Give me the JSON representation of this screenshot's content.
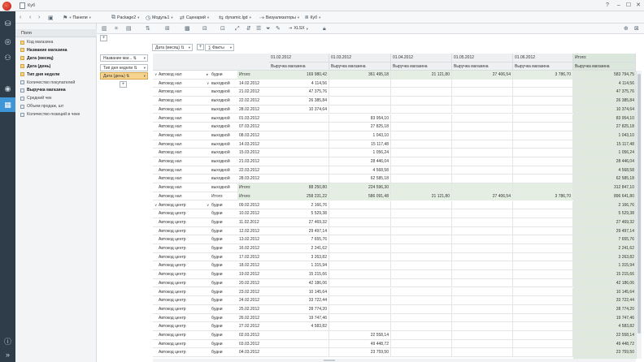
{
  "window": {
    "title": "Куб"
  },
  "toolbar": {
    "items": [
      {
        "label": "Панели",
        "icon": "panels-icon"
      },
      {
        "label": "Package2",
        "icon": "package-icon"
      },
      {
        "label": "Модуль1",
        "icon": "module-icon"
      },
      {
        "label": "Сценарий",
        "icon": "scenario-icon"
      },
      {
        "label": "dynamic.lgd",
        "icon": "file-icon"
      },
      {
        "label": "Визуализаторы",
        "icon": "visualizer-icon"
      },
      {
        "label": "Куб",
        "icon": "cube-icon"
      }
    ],
    "export_label": "XLSX"
  },
  "fields": {
    "header": "Поля",
    "items": [
      {
        "label": "Код магазина",
        "bold": false,
        "kind": "dim"
      },
      {
        "label": "Название магазина",
        "bold": true,
        "kind": "dim"
      },
      {
        "label": "Дата (месяц)",
        "bold": true,
        "kind": "dim"
      },
      {
        "label": "Дата (день)",
        "bold": true,
        "kind": "dim"
      },
      {
        "label": "Тип дня недели",
        "bold": true,
        "kind": "dim"
      },
      {
        "label": "Количество покупателей",
        "bold": false,
        "kind": "measure"
      },
      {
        "label": "Выручка магазина",
        "bold": true,
        "kind": "measure"
      },
      {
        "label": "Средний чек",
        "bold": false,
        "kind": "measure"
      },
      {
        "label": "Объем продаж, шт",
        "bold": false,
        "kind": "measure"
      },
      {
        "label": "Количество позиций в чеке",
        "bold": false,
        "kind": "measure"
      }
    ]
  },
  "pivot": {
    "col_field": "Дата (месяц)",
    "facts_label": "Факты",
    "row_fields": [
      "Название маг...",
      "Тип дня недели"
    ],
    "filter_fields": [
      "Дата (день)"
    ],
    "columns": [
      "01.02.2012",
      "01.03.2012",
      "01.04.2012",
      "01.05.2012",
      "01.06.2012"
    ],
    "total_label": "Итого:",
    "measure_label": "Выручка магазина",
    "rows": [
      {
        "store": "Автокод нал",
        "type": "будни",
        "date": "Итого:",
        "vals": [
          "169 980,42",
          "361 495,18",
          "21 121,80",
          "27 406,54",
          "3 786,70"
        ],
        "total": "583 794,75",
        "sub": true,
        "caret": "▸",
        "group": "∨"
      },
      {
        "store": "Автокод нал",
        "type": "выходной",
        "date": "14.02.2012",
        "vals": [
          "4 114,56",
          "",
          "",
          "",
          ""
        ],
        "total": "4 114,56",
        "caret": "∨"
      },
      {
        "store": "Автокод нал",
        "type": "выходной",
        "date": "21.02.2012",
        "vals": [
          "47 375,76",
          "",
          "",
          "",
          ""
        ],
        "total": "47 375,76"
      },
      {
        "store": "Автокод нал",
        "type": "выходной",
        "date": "22.02.2012",
        "vals": [
          "26 385,84",
          "",
          "",
          "",
          ""
        ],
        "total": "26 385,84"
      },
      {
        "store": "Автокод нал",
        "type": "выходной",
        "date": "28.02.2012",
        "vals": [
          "10 374,64",
          "",
          "",
          "",
          ""
        ],
        "total": "10 374,64"
      },
      {
        "store": "Автокод нал",
        "type": "выходной",
        "date": "01.03.2012",
        "vals": [
          "",
          "83 954,10",
          "",
          "",
          ""
        ],
        "total": "83 954,10"
      },
      {
        "store": "Автокод нал",
        "type": "выходной",
        "date": "07.03.2012",
        "vals": [
          "",
          "27 825,18",
          "",
          "",
          ""
        ],
        "total": "27 825,18"
      },
      {
        "store": "Автокод нал",
        "type": "выходной",
        "date": "08.03.2012",
        "vals": [
          "",
          "1 043,10",
          "",
          "",
          ""
        ],
        "total": "1 043,10"
      },
      {
        "store": "Автокод нал",
        "type": "выходной",
        "date": "14.03.2012",
        "vals": [
          "",
          "15 117,48",
          "",
          "",
          ""
        ],
        "total": "15 117,48"
      },
      {
        "store": "Автокод нал",
        "type": "выходной",
        "date": "15.03.2012",
        "vals": [
          "",
          "1 056,24",
          "",
          "",
          ""
        ],
        "total": "1 056,24"
      },
      {
        "store": "Автокод нал",
        "type": "выходной",
        "date": "21.03.2012",
        "vals": [
          "",
          "28 446,04",
          "",
          "",
          ""
        ],
        "total": "28 446,04"
      },
      {
        "store": "Автокод нал",
        "type": "выходной",
        "date": "22.03.2012",
        "vals": [
          "",
          "4 568,58",
          "",
          "",
          ""
        ],
        "total": "4 568,58"
      },
      {
        "store": "Автокод нал",
        "type": "выходной",
        "date": "28.03.2012",
        "vals": [
          "",
          "62 585,18",
          "",
          "",
          ""
        ],
        "total": "62 585,18"
      },
      {
        "store": "Автокод нал",
        "type": "выходной",
        "date": "Итого:",
        "vals": [
          "88 250,80",
          "224 596,30",
          "",
          "",
          ""
        ],
        "total": "312 847,10",
        "sub": true
      },
      {
        "store": "Автокод нал",
        "type": "Итого:",
        "date": "Итого:",
        "vals": [
          "258 231,22",
          "586 091,48",
          "21 121,80",
          "27 406,54",
          "3 786,70"
        ],
        "total": "896 641,80",
        "sub": true
      },
      {
        "store": "Автокод центр",
        "type": "будни",
        "date": "09.02.2012",
        "vals": [
          "2 166,76",
          "",
          "",
          "",
          ""
        ],
        "total": "2 166,76",
        "caret": "∨",
        "group": "∨"
      },
      {
        "store": "Автокод центр",
        "type": "будни",
        "date": "10.02.2012",
        "vals": [
          "5 529,38",
          "",
          "",
          "",
          ""
        ],
        "total": "5 529,38"
      },
      {
        "store": "Автокод центр",
        "type": "будни",
        "date": "11.02.2012",
        "vals": [
          "27 469,32",
          "",
          "",
          "",
          ""
        ],
        "total": "27 469,32"
      },
      {
        "store": "Автокод центр",
        "type": "будни",
        "date": "12.02.2012",
        "vals": [
          "29 497,14",
          "",
          "",
          "",
          ""
        ],
        "total": "29 497,14"
      },
      {
        "store": "Автокод центр",
        "type": "будни",
        "date": "13.02.2012",
        "vals": [
          "7 655,76",
          "",
          "",
          "",
          ""
        ],
        "total": "7 655,76"
      },
      {
        "store": "Автокод центр",
        "type": "будни",
        "date": "16.02.2012",
        "vals": [
          "2 241,62",
          "",
          "",
          "",
          ""
        ],
        "total": "2 241,62"
      },
      {
        "store": "Автокод центр",
        "type": "будни",
        "date": "17.02.2012",
        "vals": [
          "3 263,82",
          "",
          "",
          "",
          ""
        ],
        "total": "3 263,82"
      },
      {
        "store": "Автокод центр",
        "type": "будни",
        "date": "18.02.2012",
        "vals": [
          "1 315,94",
          "",
          "",
          "",
          ""
        ],
        "total": "1 315,94"
      },
      {
        "store": "Автокод центр",
        "type": "будни",
        "date": "19.02.2012",
        "vals": [
          "15 215,66",
          "",
          "",
          "",
          ""
        ],
        "total": "15 215,66"
      },
      {
        "store": "Автокод центр",
        "type": "будни",
        "date": "20.02.2012",
        "vals": [
          "42 186,06",
          "",
          "",
          "",
          ""
        ],
        "total": "42 186,06"
      },
      {
        "store": "Автокод центр",
        "type": "будни",
        "date": "23.02.2012",
        "vals": [
          "10 145,64",
          "",
          "",
          "",
          ""
        ],
        "total": "10 145,64"
      },
      {
        "store": "Автокод центр",
        "type": "будни",
        "date": "24.02.2012",
        "vals": [
          "33 722,44",
          "",
          "",
          "",
          ""
        ],
        "total": "33 722,44"
      },
      {
        "store": "Автокод центр",
        "type": "будни",
        "date": "25.02.2012",
        "vals": [
          "28 774,20",
          "",
          "",
          "",
          ""
        ],
        "total": "28 774,20"
      },
      {
        "store": "Автокод центр",
        "type": "будни",
        "date": "26.02.2012",
        "vals": [
          "19 747,46",
          "",
          "",
          "",
          ""
        ],
        "total": "19 747,46"
      },
      {
        "store": "Автокод центр",
        "type": "будни",
        "date": "27.02.2012",
        "vals": [
          "4 583,82",
          "",
          "",
          "",
          ""
        ],
        "total": "4 583,82"
      },
      {
        "store": "Автокод центр",
        "type": "будни",
        "date": "02.03.2012",
        "vals": [
          "",
          "22 558,14",
          "",
          "",
          ""
        ],
        "total": "22 558,14"
      },
      {
        "store": "Автокод центр",
        "type": "будни",
        "date": "03.03.2012",
        "vals": [
          "",
          "49 448,72",
          "",
          "",
          ""
        ],
        "total": "49 448,72"
      },
      {
        "store": "Автокод центр",
        "type": "будни",
        "date": "04.03.2012",
        "vals": [
          "",
          "23 759,50",
          "",
          "",
          ""
        ],
        "total": "23 759,50"
      }
    ]
  },
  "colors": {
    "nav_bg": "#2f3d4a",
    "accent": "#3f95d6",
    "total_bg": "#dfe9de",
    "chip_hl": "#f6d38e"
  }
}
